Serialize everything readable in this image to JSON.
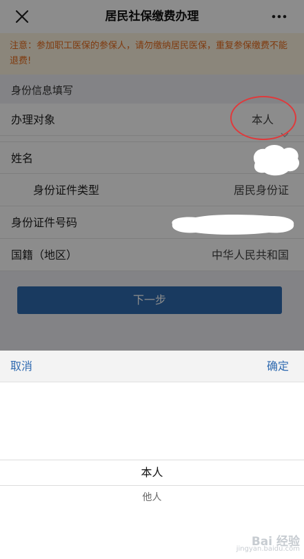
{
  "nav": {
    "title": "居民社保缴费办理",
    "close_icon": "close-icon",
    "more_icon": "more-icon"
  },
  "notice": {
    "text": "注意：参加职工医保的参保人，请勿缴纳居民医保，重复参保缴费不能退费!",
    "color": "#e76a1a"
  },
  "section": {
    "title": "身份信息填写"
  },
  "form": {
    "target": {
      "label": "办理对象",
      "value": "本人"
    },
    "name": {
      "label": "姓名"
    },
    "id_type": {
      "label": "身份证件类型",
      "value": "居民身份证"
    },
    "id_number": {
      "label": "身份证件号码"
    },
    "nationality": {
      "label": "国籍（地区）",
      "value": "中华人民共和国"
    }
  },
  "next_button": {
    "label": "下一步",
    "color": "#2f6ab0"
  },
  "picker": {
    "cancel_label": "取消",
    "confirm_label": "确定",
    "options": [
      "本人",
      "他人"
    ],
    "selected": "本人"
  },
  "watermark": {
    "logo": "Bai 经验",
    "url": "jingyan.baidu.com"
  }
}
